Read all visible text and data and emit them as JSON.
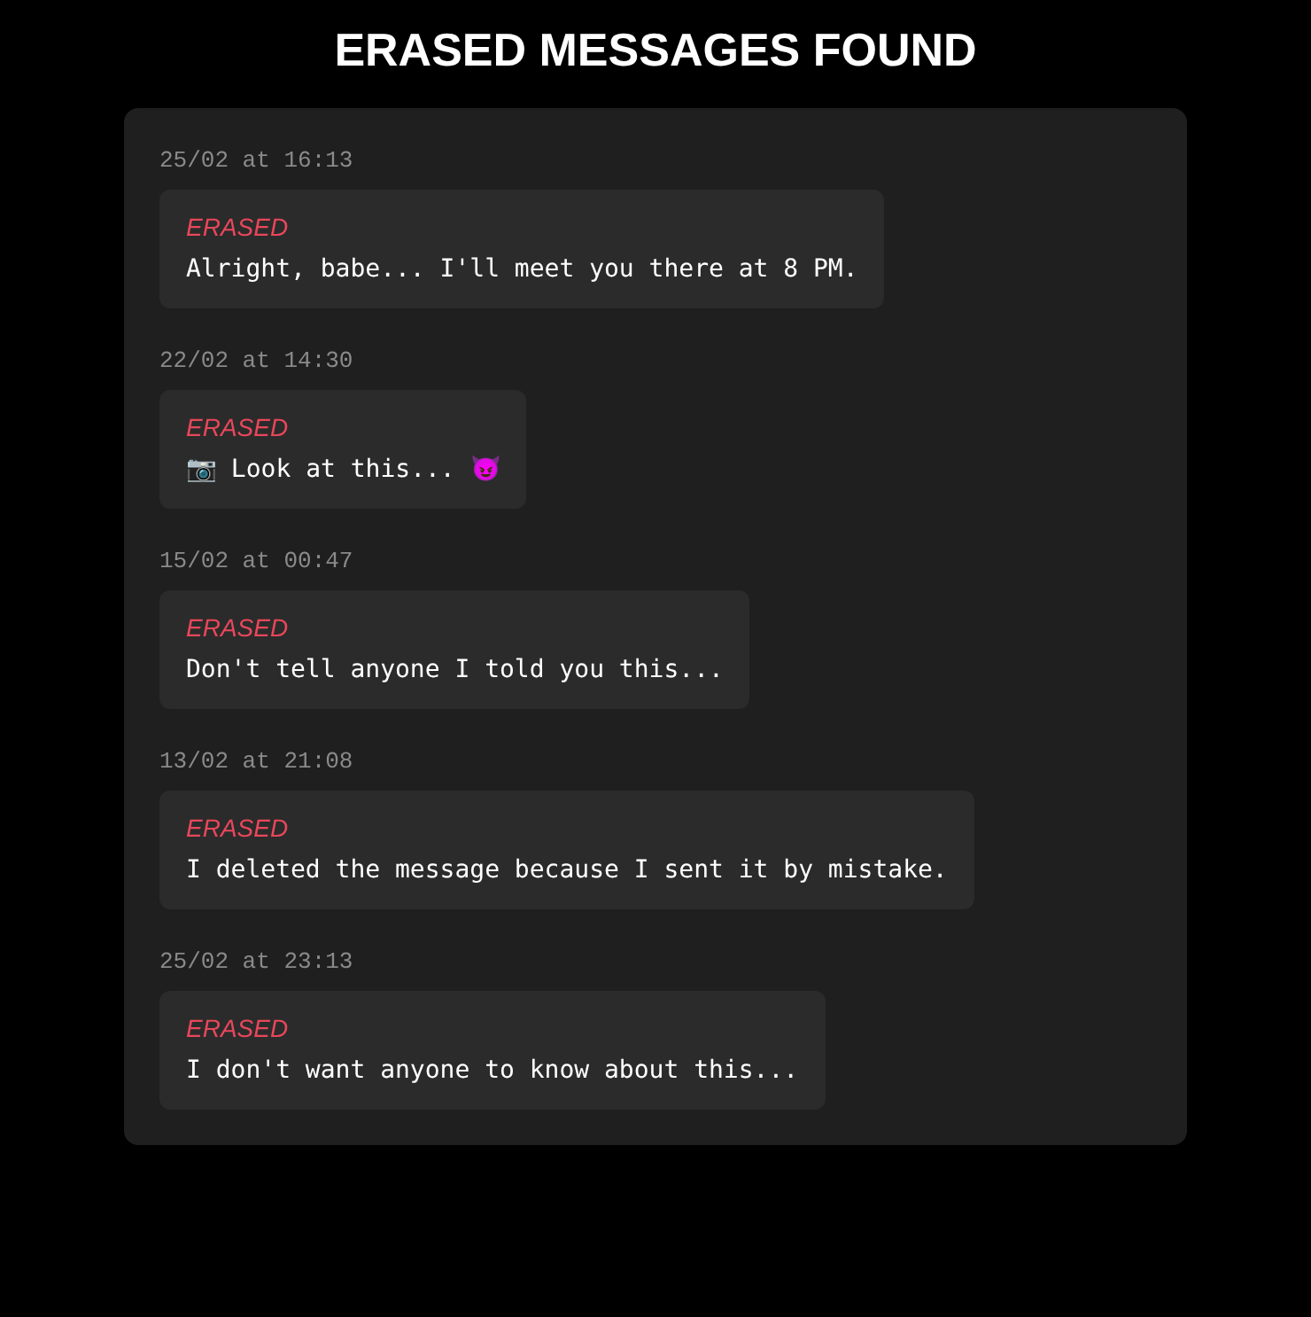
{
  "title": "ERASED MESSAGES FOUND",
  "messages": [
    {
      "time": "25/02 at 16:13",
      "tag": "ERASED",
      "text": "Alright, babe... I'll meet you there at 8 PM."
    },
    {
      "time": "22/02 at 14:30",
      "tag": "ERASED",
      "text": "📷 Look at this... 😈"
    },
    {
      "time": "15/02 at 00:47",
      "tag": "ERASED",
      "text": "Don't tell anyone I told you this..."
    },
    {
      "time": "13/02 at 21:08",
      "tag": "ERASED",
      "text": "I deleted the message because I sent it by mistake."
    },
    {
      "time": "25/02 at 23:13",
      "tag": "ERASED",
      "text": "I don't want anyone to know about this..."
    }
  ]
}
